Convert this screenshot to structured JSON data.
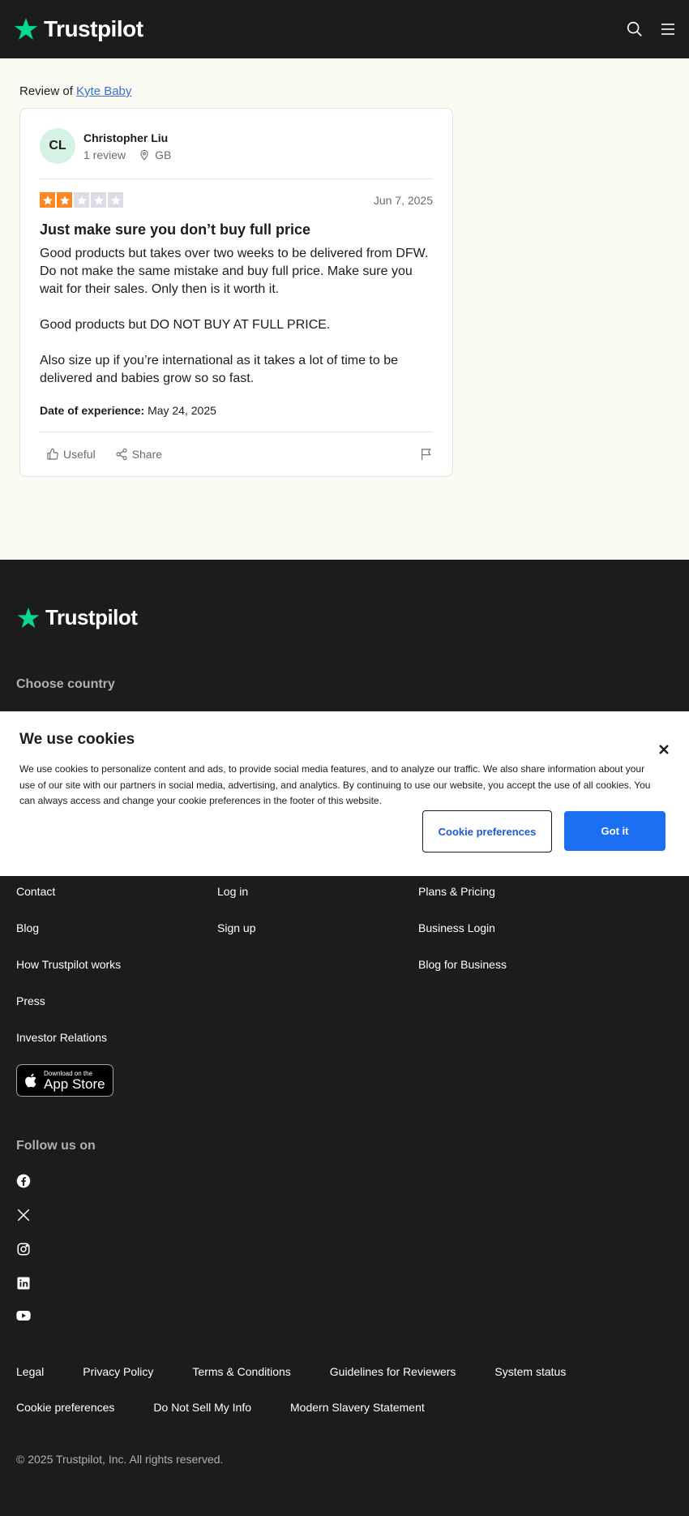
{
  "brand": {
    "name": "Trustpilot",
    "accent": "#04da8d"
  },
  "header": {
    "search_icon": "search-icon",
    "menu_icon": "hamburger-menu-icon"
  },
  "review_of": {
    "prefix": "Review of",
    "company": "Kyte Baby"
  },
  "review": {
    "reviewer": {
      "initials": "CL",
      "name": "Christopher Liu",
      "review_count": "1 review",
      "country": "GB"
    },
    "rating": 2,
    "max_rating": 5,
    "date": "Jun 7, 2025",
    "title": "Just make sure you don’t buy full price",
    "body": [
      "Good products but takes over two weeks to be delivered from DFW. Do not make the same mistake and buy full price. Make sure you wait for their sales. Only then is it worth it.",
      "Good products but DO NOT BUY AT FULL PRICE.",
      "Also size up if you’re international as it takes a lot of time to be delivered and babies grow so so fast."
    ],
    "experience_label": "Date of experience:",
    "experience_date": "May 24, 2025",
    "useful_label": "Useful",
    "share_label": "Share",
    "star_on_color": "#ff8622",
    "star_off_color": "#dcdce6"
  },
  "footer": {
    "choose_country": "Choose country",
    "col1": [
      "Contact",
      "Blog",
      "How Trustpilot works",
      "Press",
      "Investor Relations"
    ],
    "col2": [
      "Log in",
      "Sign up"
    ],
    "col3": [
      "Plans & Pricing",
      "Business Login",
      "Blog for Business"
    ],
    "appstore_small": "Download on the",
    "appstore_big": "App Store",
    "follow_us": "Follow us on",
    "legal": [
      "Legal",
      "Privacy Policy",
      "Terms & Conditions",
      "Guidelines for Reviewers",
      "System status",
      "Cookie preferences",
      "Do Not Sell My Info",
      "Modern Slavery Statement"
    ],
    "copyright": "© 2025 Trustpilot, Inc. All rights reserved."
  },
  "cookie": {
    "title": "We use cookies",
    "text": "We use cookies to personalize content and ads, to provide social media features, and to analyze our traffic. We also share information about your use of our site with our partners in social media, advertising, and analytics. By continuing to use our website, you accept the use of all cookies. You can always access and change your cookie preferences in the footer of this website.",
    "preferences_label": "Cookie preferences",
    "accept_label": "Got it"
  }
}
